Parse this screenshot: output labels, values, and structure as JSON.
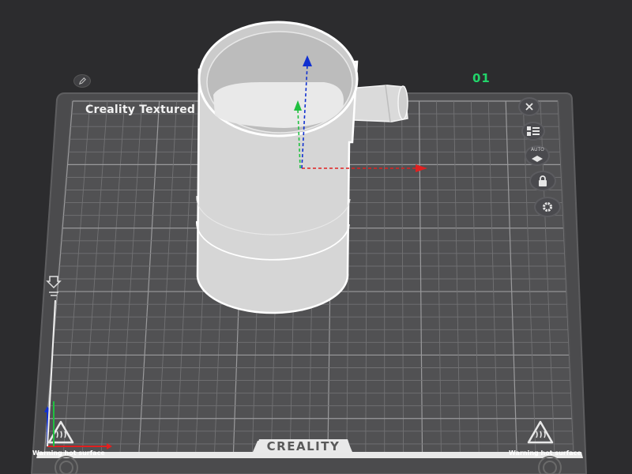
{
  "plate": {
    "name": "Creality Textured",
    "index": "01",
    "brand": "CREALITY",
    "warning_left": "Warning hot surface",
    "warning_right": "Warning hot surface"
  },
  "toolbar": {
    "auto_label": "AUTO"
  },
  "colors": {
    "background": "#2c2c2e",
    "plate": "#4b4b4d",
    "grid": "#8a8a8c",
    "model": "#d6d6d6",
    "plate_index": "#22d46a",
    "axis_x": "#e02020",
    "axis_y": "#20c040",
    "axis_z": "#1030d0"
  },
  "icons": {
    "edit": "pencil-icon",
    "close": "close-icon",
    "arrange": "list-icon",
    "auto_orient": "auto-orient-icon",
    "lock": "lock-icon",
    "settings": "gear-icon",
    "bed_origin": "nozzle-marker-icon",
    "warning": "hot-surface-icon"
  }
}
